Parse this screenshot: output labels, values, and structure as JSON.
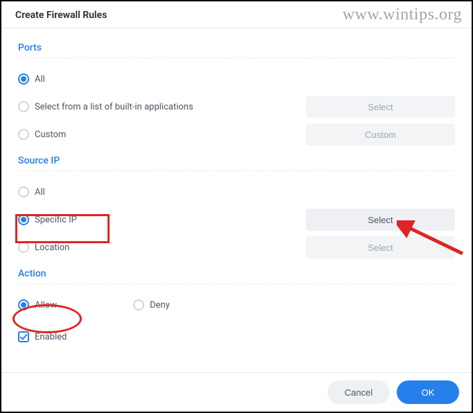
{
  "dialog": {
    "title": "Create Firewall Rules"
  },
  "ports": {
    "title": "Ports",
    "options": {
      "all": {
        "label": "All"
      },
      "builtins": {
        "label": "Select from a list of built-in applications",
        "button": "Select"
      },
      "custom": {
        "label": "Custom",
        "button": "Custom"
      }
    }
  },
  "source_ip": {
    "title": "Source IP",
    "options": {
      "all": {
        "label": "All"
      },
      "specific": {
        "label": "Specific IP",
        "button": "Select"
      },
      "location": {
        "label": "Location",
        "button": "Select"
      }
    }
  },
  "action": {
    "title": "Action",
    "allow": {
      "label": "Allow"
    },
    "deny": {
      "label": "Deny"
    }
  },
  "enabled": {
    "label": "Enabled"
  },
  "footer": {
    "cancel": "Cancel",
    "ok": "OK"
  },
  "watermark": "www.wintips.org"
}
